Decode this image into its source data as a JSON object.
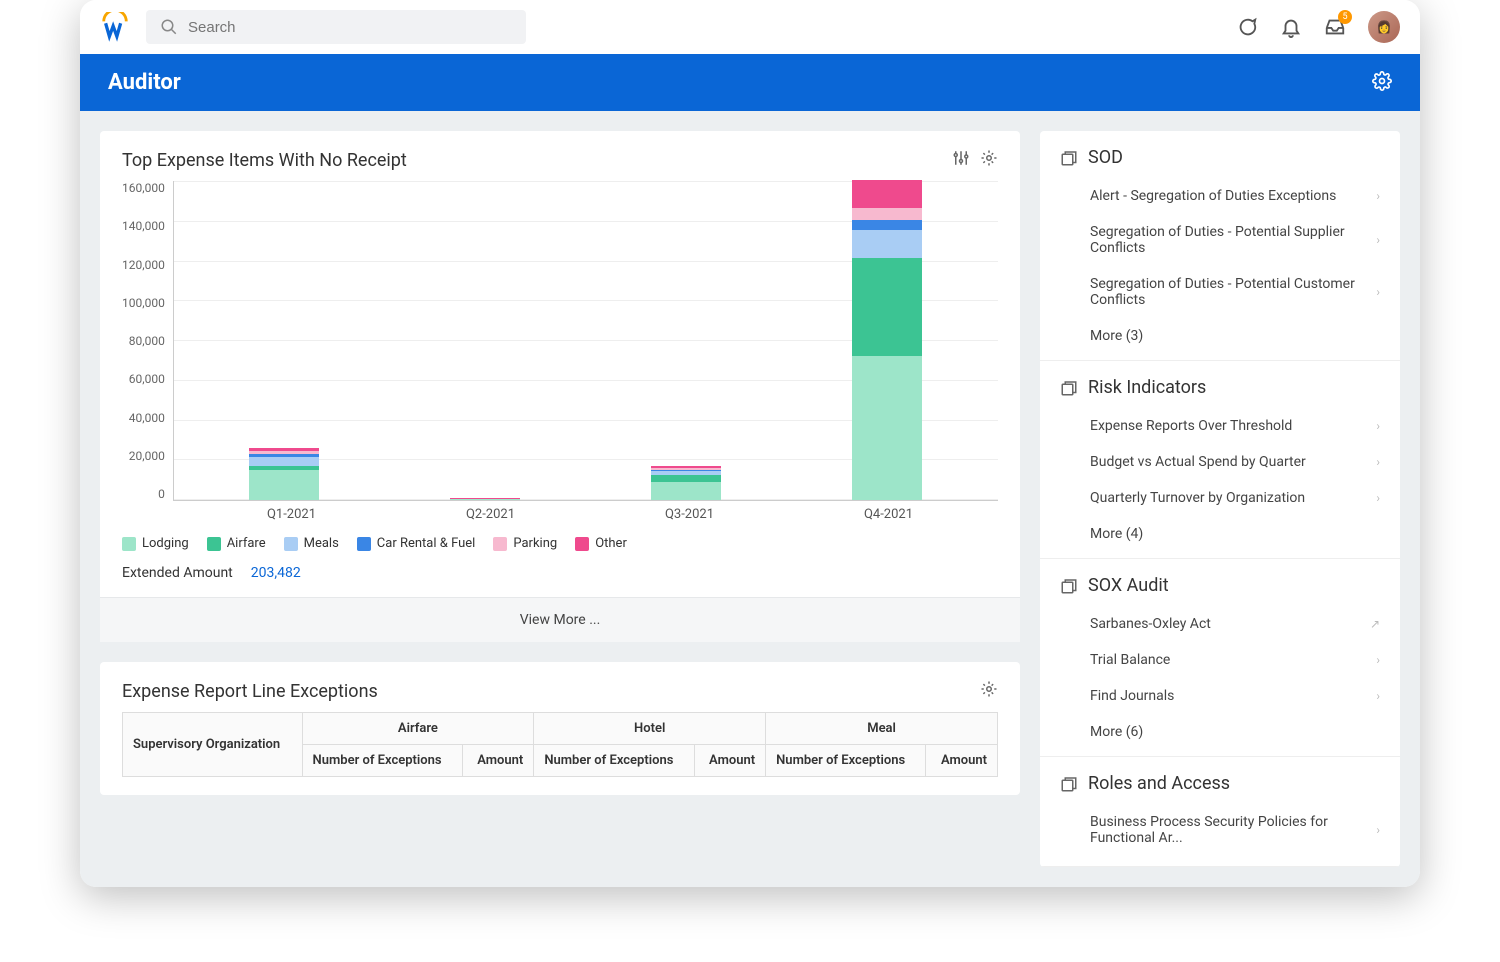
{
  "app": {
    "search_placeholder": "Search",
    "inbox_badge": "5",
    "page_title": "Auditor"
  },
  "chart_card": {
    "title": "Top Expense Items With No Receipt",
    "view_more": "View More ...",
    "extended_label": "Extended Amount",
    "extended_value": "203,482"
  },
  "chart_data": {
    "type": "bar",
    "stacked": true,
    "categories": [
      "Q1-2021",
      "Q2-2021",
      "Q3-2021",
      "Q4-2021"
    ],
    "ylabel": "",
    "xlabel": "",
    "ylim": [
      0,
      160000
    ],
    "yticks": [
      "160,000",
      "140,000",
      "120,000",
      "100,000",
      "80,000",
      "60,000",
      "40,000",
      "20,000",
      "0"
    ],
    "series": [
      {
        "name": "Lodging",
        "color": "#9de5c9",
        "values": [
          15000,
          500,
          9000,
          72000
        ]
      },
      {
        "name": "Airfare",
        "color": "#3cc493",
        "values": [
          2000,
          0,
          3500,
          49000
        ]
      },
      {
        "name": "Meals",
        "color": "#a9cdf4",
        "values": [
          4500,
          0,
          2000,
          14000
        ]
      },
      {
        "name": "Car Rental & Fuel",
        "color": "#3a86e5",
        "values": [
          1500,
          0,
          500,
          5000
        ]
      },
      {
        "name": "Parking",
        "color": "#f7b9cf",
        "values": [
          1500,
          200,
          1000,
          6000
        ]
      },
      {
        "name": "Other",
        "color": "#ef4a8d",
        "values": [
          1500,
          300,
          1000,
          14000
        ]
      }
    ]
  },
  "table_card": {
    "title": "Expense Report Line Exceptions",
    "row_header": "Supervisory Organization",
    "groups": [
      "Airfare",
      "Hotel",
      "Meal"
    ],
    "subcols": [
      "Number of Exceptions",
      "Amount"
    ]
  },
  "side": {
    "sections": [
      {
        "title": "SOD",
        "items": [
          {
            "label": "Alert - Segregation of Duties Exceptions",
            "kind": "chev"
          },
          {
            "label": "Segregation of Duties - Potential Supplier Conflicts",
            "kind": "chev"
          },
          {
            "label": "Segregation of Duties - Potential Customer Conflicts",
            "kind": "chev"
          }
        ],
        "more": "More (3)"
      },
      {
        "title": "Risk Indicators",
        "items": [
          {
            "label": "Expense Reports Over Threshold",
            "kind": "chev"
          },
          {
            "label": "Budget vs Actual Spend by Quarter",
            "kind": "chev"
          },
          {
            "label": "Quarterly Turnover by Organization",
            "kind": "chev"
          }
        ],
        "more": "More (4)"
      },
      {
        "title": "SOX Audit",
        "items": [
          {
            "label": "Sarbanes-Oxley Act",
            "kind": "ext"
          },
          {
            "label": "Trial Balance",
            "kind": "chev"
          },
          {
            "label": "Find Journals",
            "kind": "chev"
          }
        ],
        "more": "More (6)"
      },
      {
        "title": "Roles and Access",
        "items": [
          {
            "label": "Business Process Security Policies for Functional Ar...",
            "kind": "chev"
          }
        ],
        "more": null
      }
    ]
  }
}
